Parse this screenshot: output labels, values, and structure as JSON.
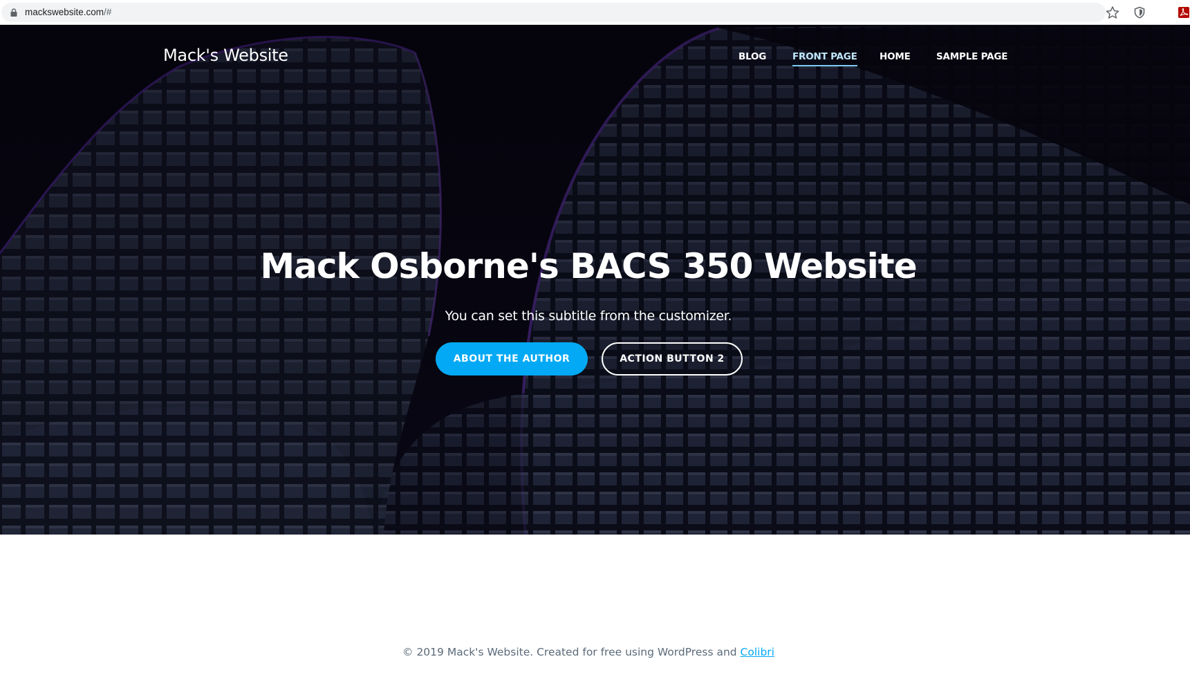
{
  "browser": {
    "url_host": "mackswebsite.com",
    "url_suffix": "/#",
    "icons": {
      "secure": "lock-icon",
      "bookmark": "star-icon",
      "extension_1": "shield-icon",
      "extension_2": "pdf-icon"
    }
  },
  "header": {
    "site_title": "Mack's Website",
    "nav": {
      "items": [
        {
          "label": "BLOG",
          "active": false
        },
        {
          "label": "FRONT PAGE",
          "active": true
        },
        {
          "label": "HOME",
          "active": false
        },
        {
          "label": "SAMPLE PAGE",
          "active": false
        }
      ]
    }
  },
  "hero": {
    "heading": "Mack Osborne's BACS 350 Website",
    "subtitle": "You can set this subtitle from the customizer.",
    "primary_button": "ABOUT THE AUTHOR",
    "secondary_button": "ACTION BUTTON 2"
  },
  "footer": {
    "text": "© 2019 Mack's Website. Created for free using WordPress and ",
    "link_text": "Colibri"
  },
  "colors": {
    "accent": "#03a9f4",
    "active_nav": "#bfe6fb",
    "hero_dark": "#0a0714",
    "footer_text": "#5b6a79"
  }
}
